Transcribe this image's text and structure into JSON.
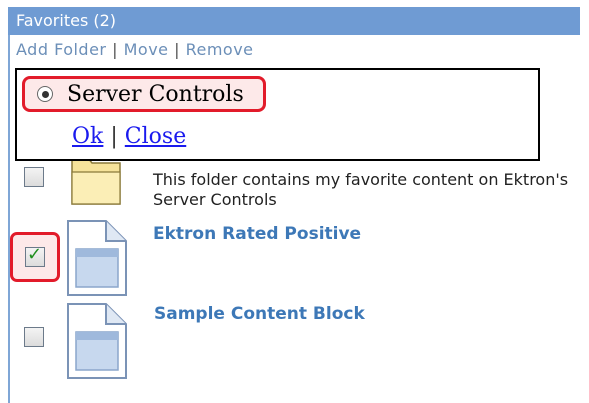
{
  "header": {
    "title": "Favorites (2)"
  },
  "toolbar": {
    "add_folder": "Add Folder",
    "move": "Move",
    "remove": "Remove",
    "separator": "|"
  },
  "popup": {
    "radio_label": "Server Controls",
    "radio_selected": true,
    "ok_label": "Ok",
    "close_label": "Close",
    "separator": "|"
  },
  "folder": {
    "description": "This folder contains my favorite content on Ektron's Server Controls",
    "checked": false
  },
  "items": [
    {
      "title": "Ektron Rated Positive",
      "checked": true
    },
    {
      "title": "Sample Content Block",
      "checked": false
    }
  ],
  "colors": {
    "header_bg": "#6f9bd3",
    "link": "#6c8fb8",
    "item_title": "#3d78b7",
    "highlight_border": "#e21b2a",
    "popup_link": "#1a1aee"
  },
  "icons": {
    "folder": "folder-icon",
    "document": "document-icon",
    "radio": "radio-selected-icon",
    "checkmark": "checkmark-icon"
  }
}
